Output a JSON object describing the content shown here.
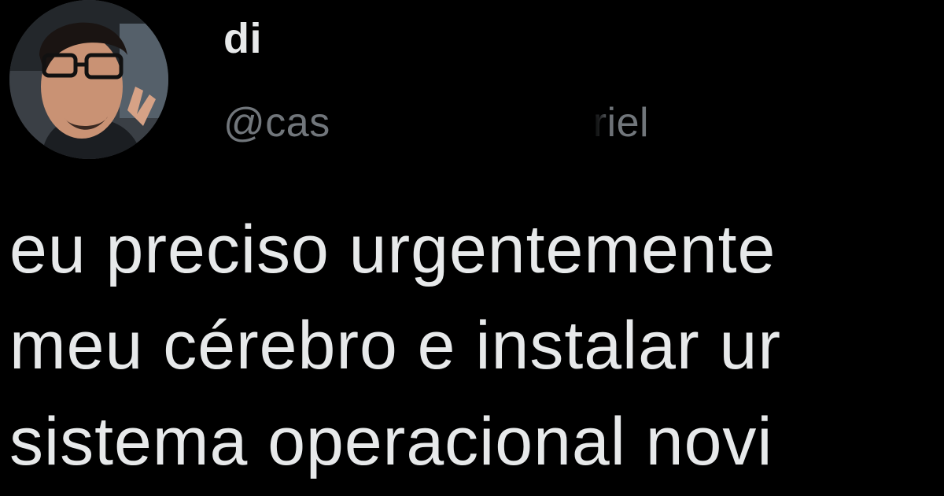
{
  "tweet": {
    "author": {
      "display_name": "di",
      "handle": "@cas",
      "handle_tail": "riel"
    },
    "text_lines": [
      "eu preciso urgentemente",
      "meu cérebro e instalar ur",
      "sistema operacional novi"
    ]
  },
  "colors": {
    "background": "#000000",
    "text": "#e7e9ea",
    "handle": "#71767b"
  }
}
